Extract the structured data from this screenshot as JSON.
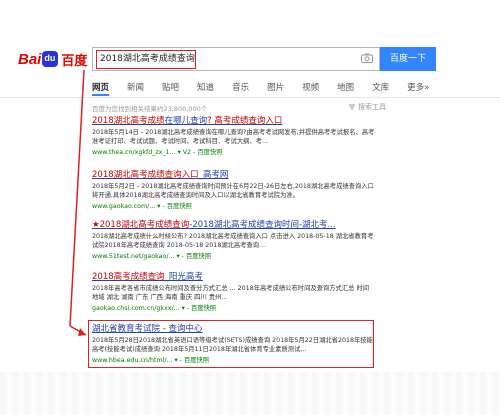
{
  "logo": {
    "part1": "Bai",
    "paw": "du",
    "part2": "百度"
  },
  "search": {
    "query": "2018湖北高考成绩查询",
    "button": "百度一下"
  },
  "tabs": [
    "网页",
    "新闻",
    "贴吧",
    "知道",
    "音乐",
    "图片",
    "视频",
    "地图",
    "文库",
    "更多»"
  ],
  "result_count": "百度为您找到相关结果约23,800,000个",
  "tools_label": "搜索工具",
  "results": [
    {
      "title_pre": "2018湖北高考成绩",
      "title_mid": "在哪儿查询",
      "title_post": "? 高考成绩查询入口",
      "abstract": "2018年5月14日 - 2018湖北高考成绩查询在哪儿查询?由高考考试网发布,并提供高考考试报名、高考准考证打印、考试试题、考试时间、考试科目、考试大纲、考...",
      "url": "www.thea.cn/xgkfd_zx_1... ▾ V2 - 百度快照"
    },
    {
      "title_pre": "2018湖北高考成绩查询入口",
      "title_mid": "_高考网",
      "title_post": "",
      "abstract": "2018年5月2日 - 2018湖北高考成绩查询时间预计在6月22日-26日左右,2018湖北高考成绩查询入口将开通,具体2018湖北高考成绩查询时间及入口以湖北省教育考试院为准。",
      "url": "www.gaokao.com/... ▾ - 百度快照"
    },
    {
      "title_pre": "★2018湖北高考成绩查询",
      "title_mid": "-2018湖北高考成绩查询时间-湖北考...",
      "title_post": "",
      "abstract": "2018湖北高考成绩什么时候公布? 2018湖北高考成绩查询入口 点击进入 2018-05-18 湖北省教育考试院2018年高考成绩查询 2018-05-18 2018湖北高考查询...",
      "url": "www.51test.net/gaokao/... ▾ - 百度快照"
    },
    {
      "title_pre": "2018高考成绩查询",
      "title_mid": "_阳光高考",
      "title_post": "",
      "abstract": "2018年高考各省市成绩公布时间及查分方式汇总 ... 2018年高考成绩公布时间及查询方式汇总 时间 地域 湖北 湖南 广东 广西 海南 重庆 四川 贵州...",
      "url": "gaokao.chsi.com.cn/gkxx/... ▾ - 百度快照"
    },
    {
      "title_pre": "湖北省教育考试院",
      "title_mid": " - 查询中心",
      "title_post": "",
      "abstract": "2018年5月28日2018湖北省英语口语等级考试(SETS)成绩查询 2018年5月22日湖北省2018年技能高考(技能考试)成绩查询 2018年5月11日2018年湖北省体育专业素质测试...",
      "url": "www.hbea.edu.cn/html/... ▾ - 百度快照"
    }
  ]
}
